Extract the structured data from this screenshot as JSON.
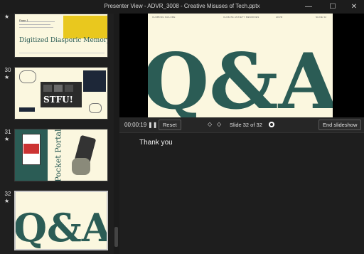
{
  "window": {
    "title": "Presenter View - ADVR_3008 - Creative Misuses of Tech.pptx",
    "minimize": "—",
    "maximize": "☐",
    "close": "✕"
  },
  "sidebar": {
    "items": [
      {
        "number": "",
        "star": "★",
        "title": "Digitized Diasporic Memory",
        "tag": "Page 1"
      },
      {
        "number": "30",
        "star": "★",
        "title": "STFU!"
      },
      {
        "number": "31",
        "star": "★",
        "title": "Pocket Portal"
      },
      {
        "number": "32",
        "star": "★",
        "title": "Q&A"
      }
    ]
  },
  "slide": {
    "big_text": "Q&A",
    "header_left": "CLIMBING FAILURE",
    "header_mid": "CLIMATE ANXIETY MEMORIES",
    "header_right": "ADVR",
    "header_far_right": "SLIDE 32"
  },
  "controls": {
    "timer": "00:00:19",
    "pause_icon": "❚❚",
    "reset_label": "Reset",
    "prev_icon": "◇",
    "next_icon": "◇",
    "slide_counter": "Slide 32 of 32",
    "end_label": "End slideshow"
  },
  "notes": {
    "text": "Thank you"
  }
}
